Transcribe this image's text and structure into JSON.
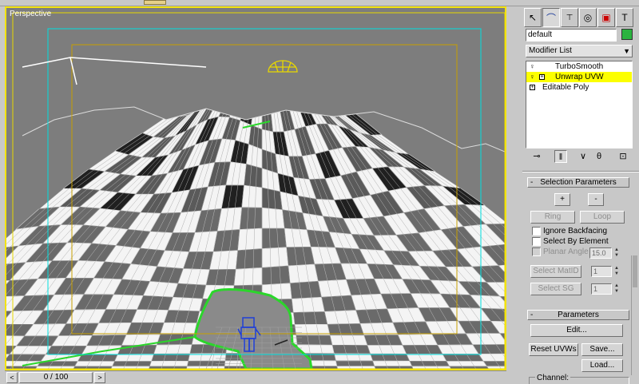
{
  "viewport": {
    "label": "Perspective"
  },
  "timeline": {
    "frame_readout": "0 / 100",
    "prev": "<",
    "next": ">"
  },
  "colors": {
    "viewport_border": "#f3e30f",
    "mesh_selection": "#2bd62b",
    "object_color": "#2bb33f",
    "stack_highlight": "#fcff00",
    "safe_frame": "#00e0e0",
    "render_frame": "#c8a000"
  },
  "command_panel": {
    "tabs": [
      {
        "name": "create-tab",
        "icon": "cursor-arrow-icon"
      },
      {
        "name": "modify-tab",
        "icon": "bend-pipe-icon"
      },
      {
        "name": "hierarchy-tab",
        "icon": "hierarchy-icon"
      },
      {
        "name": "motion-tab",
        "icon": "motion-wheel-icon"
      },
      {
        "name": "display-tab",
        "icon": "monitor-icon"
      },
      {
        "name": "utilities-tab",
        "icon": "hammer-icon"
      }
    ],
    "object_name": "default",
    "modifier_list": "Modifier List",
    "modifier_stack": [
      {
        "label": "TurboSmooth",
        "on": true,
        "expandable": false,
        "selected": false
      },
      {
        "label": "Unwrap UVW",
        "on": true,
        "expandable": true,
        "selected": true
      },
      {
        "label": "Editable Poly",
        "on": false,
        "expandable": true,
        "selected": false
      }
    ],
    "stack_tools": [
      "pin-stack-icon",
      "show-end-result-icon",
      "make-unique-icon",
      "remove-modifier-icon",
      "configure-sets-icon"
    ]
  },
  "selection_parameters": {
    "title": "Selection Parameters",
    "grow": "+",
    "shrink": "-",
    "ring": "Ring",
    "loop": "Loop",
    "ignore_backfacing": "Ignore Backfacing",
    "select_by_element": "Select By Element",
    "planar_angle_label": "Planar Angle",
    "planar_angle_value": "15.0",
    "select_matid": "Select MatID",
    "matid_value": "1",
    "select_sg": "Select SG",
    "sg_value": "1"
  },
  "parameters": {
    "title": "Parameters",
    "edit": "Edit...",
    "reset_uvws": "Reset UVWs",
    "save": "Save...",
    "load": "Load...",
    "channel": "Channel:"
  }
}
